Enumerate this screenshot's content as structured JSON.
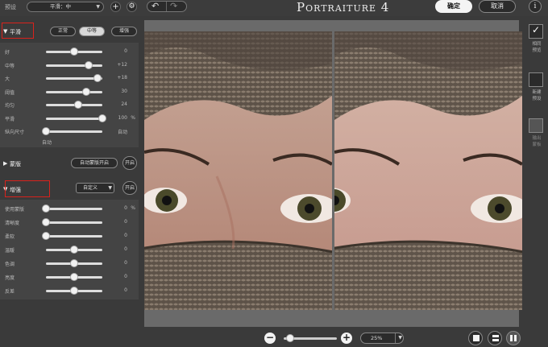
{
  "topbar": {
    "preset_label": "预设",
    "preset_value": "平滑：中",
    "add_icon": "plus-icon",
    "settings_icon": "gear-icon",
    "undo_icon": "undo-icon",
    "redo_icon": "redo-icon",
    "title": "Portraiture 4",
    "ok_label": "确定",
    "cancel_label": "取消",
    "info_label": "i"
  },
  "smoothing": {
    "name": "平滑",
    "modes": [
      "正常",
      "中等",
      "增强"
    ],
    "selected_mode": "中等",
    "sliders": [
      {
        "label": "好",
        "value": "0",
        "unit": "",
        "level": 0.5
      },
      {
        "label": "中等",
        "value": "+12",
        "unit": "",
        "level": 0.76
      },
      {
        "label": "大",
        "value": "+18",
        "unit": "",
        "level": 0.92
      },
      {
        "label": "阈值",
        "value": "30",
        "unit": "",
        "level": 0.72
      },
      {
        "label": "均匀",
        "value": "24",
        "unit": "",
        "level": 0.57
      },
      {
        "label": "平滑",
        "value": "100",
        "unit": "%",
        "level": 1.0
      },
      {
        "label": "纵向尺寸",
        "value": "自动",
        "unit": "",
        "level": 0.0
      }
    ],
    "sub_auto": "自动"
  },
  "mask": {
    "name": "蒙版",
    "auto_mask_label": "自动蒙版开启",
    "toggle_label": "开启"
  },
  "enhance": {
    "name": "增强",
    "preset_value": "自定义",
    "toggle_label": "开启",
    "sliders": [
      {
        "label": "使用蒙版",
        "value": "0",
        "unit": "%",
        "level": 0.0
      },
      {
        "label": "清晰度",
        "value": "0",
        "unit": "",
        "level": 0.0
      },
      {
        "label": "柔软",
        "value": "0",
        "unit": "",
        "level": 0.0
      },
      {
        "label": "温暖",
        "value": "0",
        "unit": "",
        "level": 0.5
      },
      {
        "label": "色调",
        "value": "0",
        "unit": "",
        "level": 0.5
      },
      {
        "label": "亮度",
        "value": "0",
        "unit": "",
        "level": 0.5
      },
      {
        "label": "反差",
        "value": "0",
        "unit": "",
        "level": 0.5
      }
    ]
  },
  "right_sidebar": {
    "items": [
      {
        "label": "相同\n预览",
        "checked": true
      },
      {
        "label": "新建\n预设",
        "checked": false
      },
      {
        "label": "输出\n蒙板",
        "checked": false
      }
    ]
  },
  "bottombar": {
    "zoom_out_icon": "minus-icon",
    "zoom_in_icon": "plus-icon",
    "zoom_level": "25%",
    "zoom_fraction": 0.05,
    "view_modes": [
      "single-view-icon",
      "split-horizontal-icon",
      "split-vertical-icon"
    ],
    "selected_view": "split-vertical-icon"
  },
  "colors": {
    "highlight_box": "#d9221c",
    "panel_bg": "#3a3a3a",
    "slider_bg": "#444444",
    "viewer_bg": "#6a6a6a"
  }
}
